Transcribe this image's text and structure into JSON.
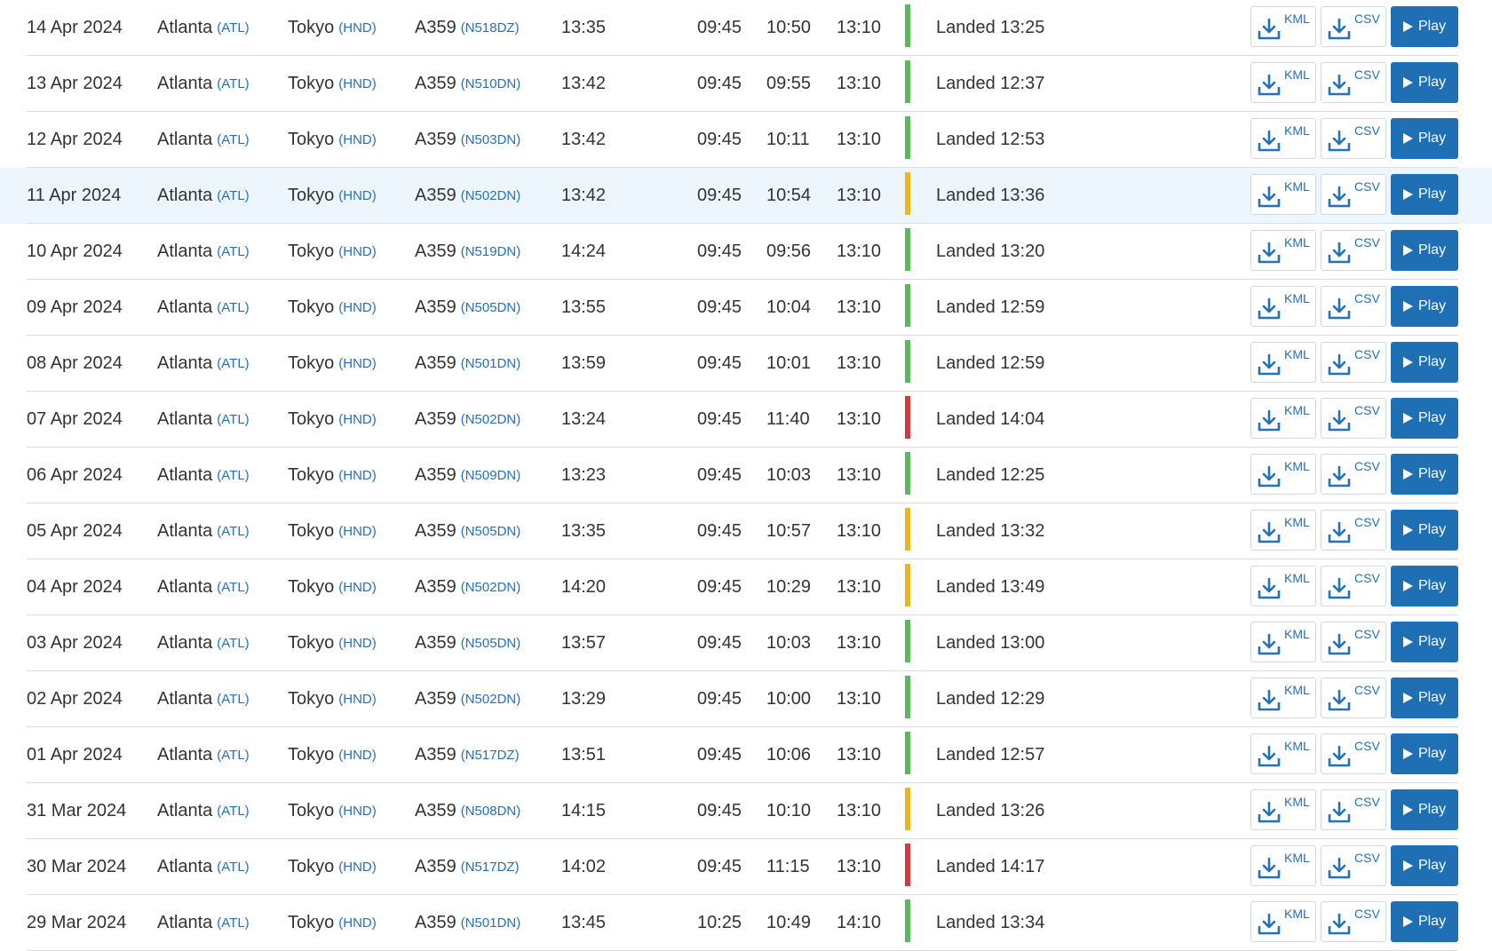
{
  "colors": {
    "ontime": "#5cb85c",
    "delayed": "#f0b41e",
    "late": "#d9383a",
    "link": "#2471b5",
    "play_button": "#1f6fb5",
    "highlight_row": "#eef6fd"
  },
  "labels": {
    "kml": "KML",
    "csv": "CSV",
    "play": "Play"
  },
  "icons": {
    "download": "download-icon",
    "play": "play-icon"
  },
  "flights": [
    {
      "date": "14 Apr 2024",
      "from_city": "Atlanta",
      "from_code": "(ATL)",
      "to_city": "Tokyo",
      "to_code": "(HND)",
      "aircraft": "A359",
      "reg": "(N518DZ)",
      "duration": "13:35",
      "std": "09:45",
      "atd": "10:50",
      "sta": "13:10",
      "status": "Landed 13:25",
      "status_color": "ontime",
      "highlight": false
    },
    {
      "date": "13 Apr 2024",
      "from_city": "Atlanta",
      "from_code": "(ATL)",
      "to_city": "Tokyo",
      "to_code": "(HND)",
      "aircraft": "A359",
      "reg": "(N510DN)",
      "duration": "13:42",
      "std": "09:45",
      "atd": "09:55",
      "sta": "13:10",
      "status": "Landed 12:37",
      "status_color": "ontime",
      "highlight": false
    },
    {
      "date": "12 Apr 2024",
      "from_city": "Atlanta",
      "from_code": "(ATL)",
      "to_city": "Tokyo",
      "to_code": "(HND)",
      "aircraft": "A359",
      "reg": "(N503DN)",
      "duration": "13:42",
      "std": "09:45",
      "atd": "10:11",
      "sta": "13:10",
      "status": "Landed 12:53",
      "status_color": "ontime",
      "highlight": false
    },
    {
      "date": "11 Apr 2024",
      "from_city": "Atlanta",
      "from_code": "(ATL)",
      "to_city": "Tokyo",
      "to_code": "(HND)",
      "aircraft": "A359",
      "reg": "(N502DN)",
      "duration": "13:42",
      "std": "09:45",
      "atd": "10:54",
      "sta": "13:10",
      "status": "Landed 13:36",
      "status_color": "delayed",
      "highlight": true
    },
    {
      "date": "10 Apr 2024",
      "from_city": "Atlanta",
      "from_code": "(ATL)",
      "to_city": "Tokyo",
      "to_code": "(HND)",
      "aircraft": "A359",
      "reg": "(N519DN)",
      "duration": "14:24",
      "std": "09:45",
      "atd": "09:56",
      "sta": "13:10",
      "status": "Landed 13:20",
      "status_color": "ontime",
      "highlight": false
    },
    {
      "date": "09 Apr 2024",
      "from_city": "Atlanta",
      "from_code": "(ATL)",
      "to_city": "Tokyo",
      "to_code": "(HND)",
      "aircraft": "A359",
      "reg": "(N505DN)",
      "duration": "13:55",
      "std": "09:45",
      "atd": "10:04",
      "sta": "13:10",
      "status": "Landed 12:59",
      "status_color": "ontime",
      "highlight": false
    },
    {
      "date": "08 Apr 2024",
      "from_city": "Atlanta",
      "from_code": "(ATL)",
      "to_city": "Tokyo",
      "to_code": "(HND)",
      "aircraft": "A359",
      "reg": "(N501DN)",
      "duration": "13:59",
      "std": "09:45",
      "atd": "10:01",
      "sta": "13:10",
      "status": "Landed 12:59",
      "status_color": "ontime",
      "highlight": false
    },
    {
      "date": "07 Apr 2024",
      "from_city": "Atlanta",
      "from_code": "(ATL)",
      "to_city": "Tokyo",
      "to_code": "(HND)",
      "aircraft": "A359",
      "reg": "(N502DN)",
      "duration": "13:24",
      "std": "09:45",
      "atd": "11:40",
      "sta": "13:10",
      "status": "Landed 14:04",
      "status_color": "late",
      "highlight": false
    },
    {
      "date": "06 Apr 2024",
      "from_city": "Atlanta",
      "from_code": "(ATL)",
      "to_city": "Tokyo",
      "to_code": "(HND)",
      "aircraft": "A359",
      "reg": "(N509DN)",
      "duration": "13:23",
      "std": "09:45",
      "atd": "10:03",
      "sta": "13:10",
      "status": "Landed 12:25",
      "status_color": "ontime",
      "highlight": false
    },
    {
      "date": "05 Apr 2024",
      "from_city": "Atlanta",
      "from_code": "(ATL)",
      "to_city": "Tokyo",
      "to_code": "(HND)",
      "aircraft": "A359",
      "reg": "(N505DN)",
      "duration": "13:35",
      "std": "09:45",
      "atd": "10:57",
      "sta": "13:10",
      "status": "Landed 13:32",
      "status_color": "delayed",
      "highlight": false
    },
    {
      "date": "04 Apr 2024",
      "from_city": "Atlanta",
      "from_code": "(ATL)",
      "to_city": "Tokyo",
      "to_code": "(HND)",
      "aircraft": "A359",
      "reg": "(N502DN)",
      "duration": "14:20",
      "std": "09:45",
      "atd": "10:29",
      "sta": "13:10",
      "status": "Landed 13:49",
      "status_color": "delayed",
      "highlight": false
    },
    {
      "date": "03 Apr 2024",
      "from_city": "Atlanta",
      "from_code": "(ATL)",
      "to_city": "Tokyo",
      "to_code": "(HND)",
      "aircraft": "A359",
      "reg": "(N505DN)",
      "duration": "13:57",
      "std": "09:45",
      "atd": "10:03",
      "sta": "13:10",
      "status": "Landed 13:00",
      "status_color": "ontime",
      "highlight": false
    },
    {
      "date": "02 Apr 2024",
      "from_city": "Atlanta",
      "from_code": "(ATL)",
      "to_city": "Tokyo",
      "to_code": "(HND)",
      "aircraft": "A359",
      "reg": "(N502DN)",
      "duration": "13:29",
      "std": "09:45",
      "atd": "10:00",
      "sta": "13:10",
      "status": "Landed 12:29",
      "status_color": "ontime",
      "highlight": false
    },
    {
      "date": "01 Apr 2024",
      "from_city": "Atlanta",
      "from_code": "(ATL)",
      "to_city": "Tokyo",
      "to_code": "(HND)",
      "aircraft": "A359",
      "reg": "(N517DZ)",
      "duration": "13:51",
      "std": "09:45",
      "atd": "10:06",
      "sta": "13:10",
      "status": "Landed 12:57",
      "status_color": "ontime",
      "highlight": false
    },
    {
      "date": "31 Mar 2024",
      "from_city": "Atlanta",
      "from_code": "(ATL)",
      "to_city": "Tokyo",
      "to_code": "(HND)",
      "aircraft": "A359",
      "reg": "(N508DN)",
      "duration": "14:15",
      "std": "09:45",
      "atd": "10:10",
      "sta": "13:10",
      "status": "Landed 13:26",
      "status_color": "delayed",
      "highlight": false
    },
    {
      "date": "30 Mar 2024",
      "from_city": "Atlanta",
      "from_code": "(ATL)",
      "to_city": "Tokyo",
      "to_code": "(HND)",
      "aircraft": "A359",
      "reg": "(N517DZ)",
      "duration": "14:02",
      "std": "09:45",
      "atd": "11:15",
      "sta": "13:10",
      "status": "Landed 14:17",
      "status_color": "late",
      "highlight": false
    },
    {
      "date": "29 Mar 2024",
      "from_city": "Atlanta",
      "from_code": "(ATL)",
      "to_city": "Tokyo",
      "to_code": "(HND)",
      "aircraft": "A359",
      "reg": "(N501DN)",
      "duration": "13:45",
      "std": "10:25",
      "atd": "10:49",
      "sta": "14:10",
      "status": "Landed 13:34",
      "status_color": "ontime",
      "highlight": false
    }
  ]
}
